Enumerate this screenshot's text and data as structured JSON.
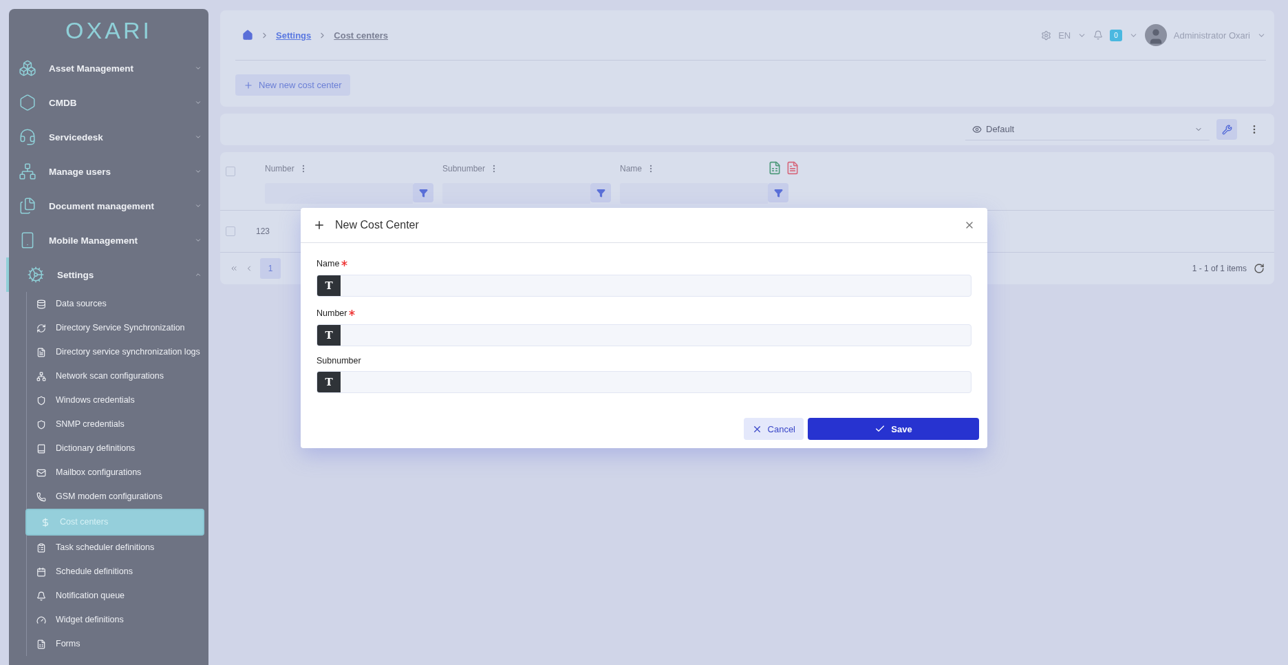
{
  "sidebar": {
    "logo": "OXARI",
    "items": [
      {
        "label": "Asset Management",
        "expanded": false,
        "active": false
      },
      {
        "label": "CMDB",
        "expanded": false,
        "active": false
      },
      {
        "label": "Servicedesk",
        "expanded": false,
        "active": false
      },
      {
        "label": "Manage users",
        "expanded": false,
        "active": false
      },
      {
        "label": "Document management",
        "expanded": false,
        "active": false
      },
      {
        "label": "Mobile Management",
        "expanded": false,
        "active": false
      },
      {
        "label": "Settings",
        "expanded": true,
        "active": true,
        "children": [
          {
            "label": "Data sources",
            "selected": false
          },
          {
            "label": "Directory Service Synchronization",
            "selected": false
          },
          {
            "label": "Directory service synchronization logs",
            "selected": false
          },
          {
            "label": "Network scan configurations",
            "selected": false
          },
          {
            "label": "Windows credentials",
            "selected": false
          },
          {
            "label": "SNMP credentials",
            "selected": false
          },
          {
            "label": "Dictionary definitions",
            "selected": false
          },
          {
            "label": "Mailbox configurations",
            "selected": false
          },
          {
            "label": "GSM modem configurations",
            "selected": false
          },
          {
            "label": "Cost centers",
            "selected": true
          },
          {
            "label": "Task scheduler definitions",
            "selected": false
          },
          {
            "label": "Schedule definitions",
            "selected": false
          },
          {
            "label": "Notification queue",
            "selected": false
          },
          {
            "label": "Widget definitions",
            "selected": false
          },
          {
            "label": "Forms",
            "selected": false
          }
        ]
      }
    ]
  },
  "breadcrumb": [
    {
      "label": "Settings",
      "kind": "link"
    },
    {
      "label": "Cost centers",
      "kind": "current"
    }
  ],
  "header": {
    "language": "EN",
    "notifications": "0",
    "user": "Administrator Oxari"
  },
  "new_button": "New new cost center",
  "view_select": {
    "value": "Default"
  },
  "table": {
    "all_checked": false,
    "columns": [
      "Number",
      "Subnumber",
      "Name"
    ],
    "rows": [
      {
        "cells": [
          "123"
        ],
        "checked": false
      }
    ]
  },
  "pagination": {
    "pages": [
      {
        "label": "1",
        "selected": true
      }
    ],
    "summary": "1 - 1 of 1 items"
  },
  "dialog": {
    "title": "New Cost Center",
    "fields": [
      {
        "label": "Name",
        "required": true,
        "prefix": "T"
      },
      {
        "label": "Number",
        "required": true,
        "prefix": "T"
      },
      {
        "label": "Subnumber",
        "required": false,
        "prefix": "T"
      }
    ],
    "buttons": [
      {
        "label": "Cancel",
        "kind": "secondary"
      },
      {
        "label": "Save",
        "kind": "primary"
      }
    ]
  }
}
